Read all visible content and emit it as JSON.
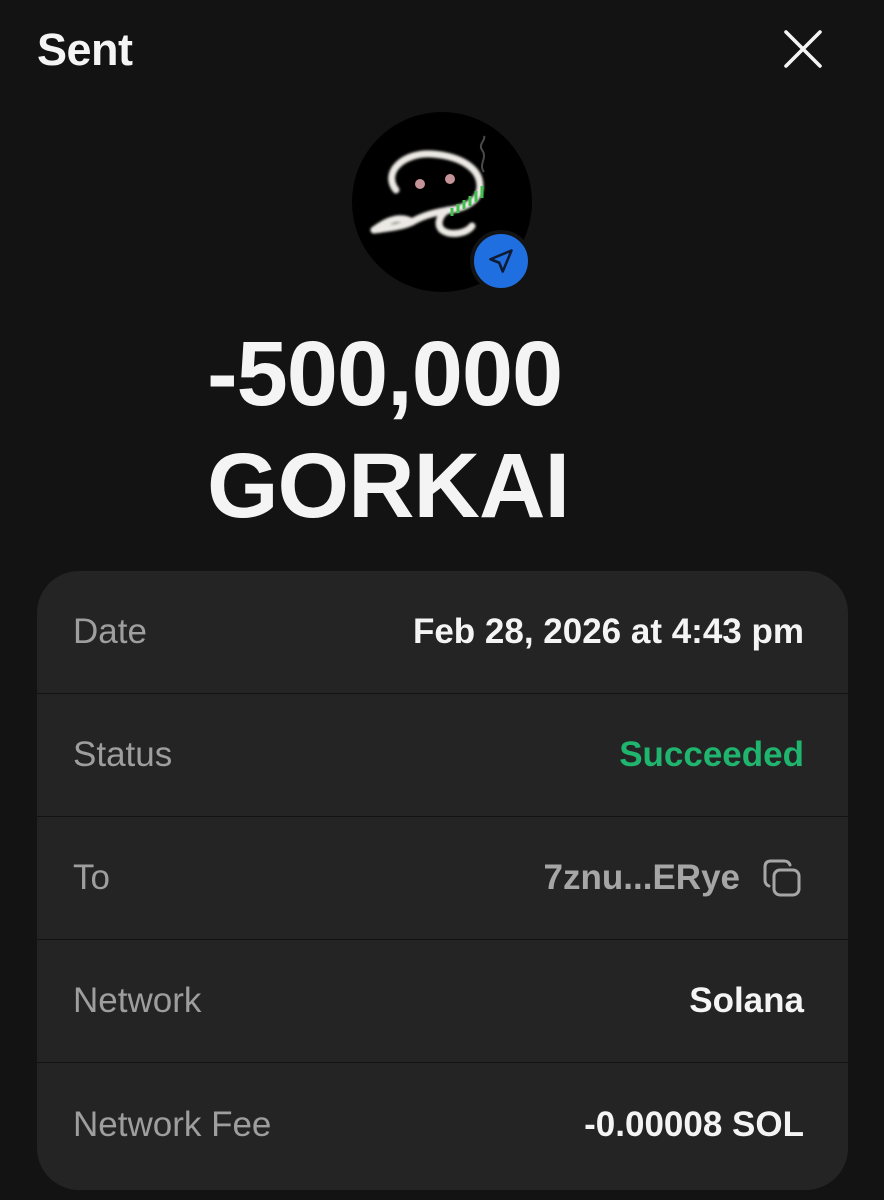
{
  "header": {
    "title": "Sent"
  },
  "token": {
    "icon": "gorkai-token-logo",
    "badge_icon": "send-arrow-icon",
    "badge_color": "#1f6fe0",
    "amount": "-500,000",
    "symbol": "GORKAI"
  },
  "details": {
    "rows": [
      {
        "label": "Date",
        "value": "Feb 28, 2026 at 4:43 pm"
      },
      {
        "label": "Status",
        "value": "Succeeded",
        "color": "#20b56e"
      },
      {
        "label": "To",
        "value": "7znu...ERye",
        "icon": "copy-icon"
      },
      {
        "label": "Network",
        "value": "Solana"
      },
      {
        "label": "Network Fee",
        "value": "-0.00008 SOL"
      }
    ]
  }
}
